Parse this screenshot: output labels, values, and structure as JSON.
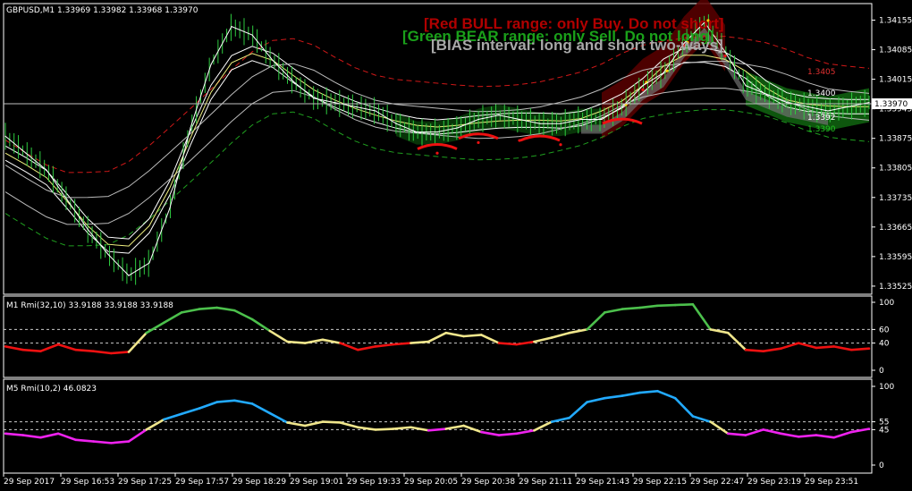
{
  "chart_data": [
    {
      "type": "line",
      "title": "GBPUSD,M1  1.33969 1.33982 1.33968 1.33970",
      "symbol": "GBPUSD,M1",
      "ohlc": {
        "open": "1.33969",
        "high": "1.33982",
        "low": "1.33968",
        "close": "1.33970"
      },
      "price_ticks": [
        "1.34155",
        "1.34085",
        "1.34015",
        "1.33945",
        "1.33875",
        "1.33805",
        "1.33735",
        "1.33665",
        "1.33595",
        "1.33525"
      ],
      "ylim": [
        1.3351,
        1.3419
      ],
      "current_price": "1.33970",
      "level_labels": [
        {
          "text": "1.3405",
          "price": 1.34033,
          "color": "#e03030"
        },
        {
          "text": "1.3400",
          "price": 1.33982,
          "color": "#ffffff"
        },
        {
          "text": "1.3392",
          "price": 1.33925,
          "color": "#ffffff"
        },
        {
          "text": "1.3390",
          "price": 1.33898,
          "color": "#20c020"
        }
      ],
      "annotations": [
        {
          "text": "[Red BULL range: only Buy. Do not short]",
          "color": "#b00000"
        },
        {
          "text": "[Green BEAR range: only Sell. Do not long]",
          "color": "#1aa01a"
        },
        {
          "text": "[BIAS interval: long and short two-ways]",
          "color": "#a8a8a8"
        }
      ],
      "series": [
        {
          "values": [
            1.3388,
            1.3384,
            1.338,
            1.3373,
            1.3366,
            1.336,
            1.3355,
            1.3358,
            1.3371,
            1.339,
            1.3405,
            1.3414,
            1.3412,
            1.3406,
            1.3401,
            1.3397,
            1.3396,
            1.3395,
            1.3394,
            1.3391,
            1.3389,
            1.3389,
            1.339,
            1.3392,
            1.3393,
            1.3392,
            1.3391,
            1.3391,
            1.3392,
            1.3392,
            1.3395,
            1.34,
            1.3403,
            1.341,
            1.3415,
            1.3408,
            1.34,
            1.3398,
            1.3396,
            1.3395,
            1.3394,
            1.3395,
            1.3396
          ]
        }
      ]
    },
    {
      "type": "line",
      "title": "M1 Rmi(32,10) 33.9188 33.9188 33.9188",
      "yticks": [
        "100",
        "60",
        "40",
        "0"
      ],
      "levels": [
        60,
        40
      ],
      "ylim": [
        0,
        100
      ],
      "values": [
        35,
        30,
        28,
        38,
        30,
        28,
        25,
        27,
        55,
        70,
        85,
        90,
        92,
        88,
        75,
        58,
        42,
        40,
        45,
        40,
        30,
        35,
        38,
        40,
        42,
        55,
        50,
        52,
        40,
        38,
        42,
        48,
        55,
        60,
        85,
        90,
        92,
        95,
        96,
        97,
        60,
        55,
        30,
        28,
        32,
        40,
        33,
        35,
        30,
        32
      ]
    },
    {
      "type": "line",
      "title": "M5 Rmi(10,2) 46.0823",
      "yticks": [
        "100",
        "55",
        "45",
        "0"
      ],
      "levels": [
        55,
        45
      ],
      "ylim": [
        0,
        100
      ],
      "values": [
        40,
        38,
        35,
        40,
        32,
        30,
        28,
        30,
        45,
        58,
        65,
        72,
        80,
        82,
        78,
        66,
        54,
        50,
        55,
        54,
        48,
        45,
        46,
        48,
        44,
        46,
        50,
        42,
        38,
        40,
        44,
        55,
        60,
        80,
        85,
        88,
        92,
        94,
        85,
        62,
        55,
        40,
        38,
        45,
        40,
        36,
        38,
        35,
        42,
        46
      ]
    }
  ],
  "time_axis": {
    "labels": [
      "29 Sep 2017",
      "29 Sep 16:53",
      "29 Sep 17:25",
      "29 Sep 17:57",
      "29 Sep 18:29",
      "29 Sep 19:01",
      "29 Sep 19:33",
      "29 Sep 20:05",
      "29 Sep 20:38",
      "29 Sep 21:11",
      "29 Sep 21:43",
      "29 Sep 22:15",
      "29 Sep 22:47",
      "29 Sep 23:19",
      "29 Sep 23:51"
    ]
  },
  "colors": {
    "background": "#000000",
    "axis": "#ffffff",
    "candles": "#2ecc40",
    "price_line": "#ffffff",
    "upper_band": "#d01818",
    "lower_band": "#1f9f1f",
    "bull_zone": "#5a0000",
    "bear_zone": "#0f5f0f",
    "bias_zone": "#707070",
    "rmi_up": "#4cc04c",
    "rmi_down": "#ee1111",
    "rmi_neutral": "#f0e68c",
    "m5_up": "#22aaff",
    "m5_down": "#ee22ee",
    "m5_neutral": "#f0e68c"
  }
}
